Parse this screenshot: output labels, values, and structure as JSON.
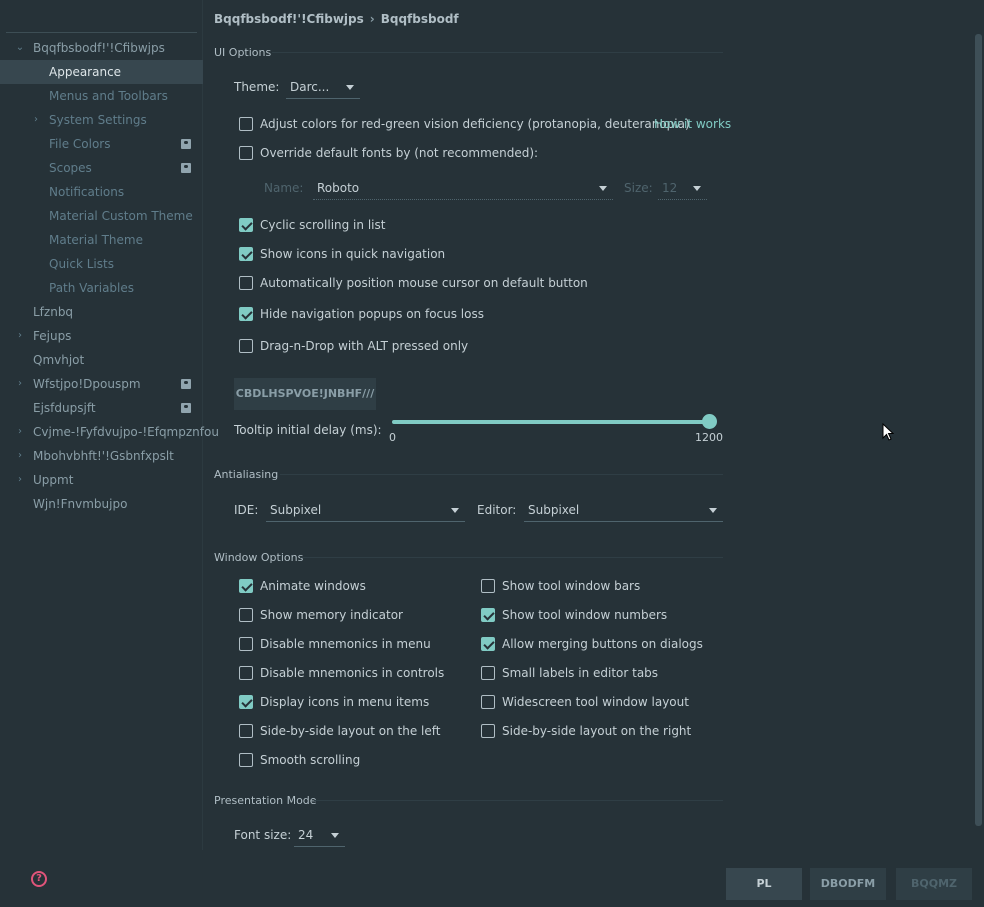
{
  "breadcrumb": {
    "parent": "Bqqfbsbodf!'!Cfibwjps",
    "current": "Bqqfbsbodf",
    "separator": "›"
  },
  "sidebar": {
    "items": [
      {
        "label": "Bqqfbsbodf!'!Cfibwjps",
        "arrow": "⌄",
        "level": 0
      },
      {
        "label": "Appearance",
        "level": 1
      },
      {
        "label": "Menus and Toolbars",
        "level": 1
      },
      {
        "label": "System Settings",
        "arrow": "›",
        "level": 1
      },
      {
        "label": "File Colors",
        "level": 1,
        "badge": true
      },
      {
        "label": "Scopes",
        "level": 1,
        "badge": true
      },
      {
        "label": "Notifications",
        "level": 1
      },
      {
        "label": "Material Custom Theme",
        "level": 1
      },
      {
        "label": "Material Theme",
        "level": 1
      },
      {
        "label": "Quick Lists",
        "level": 1
      },
      {
        "label": "Path Variables",
        "level": 1
      },
      {
        "label": "Lfznbq",
        "level": 0
      },
      {
        "label": "Fejups",
        "arrow": "›",
        "level": 0
      },
      {
        "label": "Qmvhjot",
        "level": 0
      },
      {
        "label": "Wfstjpo!Dpouspm",
        "arrow": "›",
        "level": 0,
        "badge": true
      },
      {
        "label": "Ejsfdupsjft",
        "level": 0,
        "badge": true
      },
      {
        "label": "Cvjme-!Fyfdvujpo-!Efqmpznfou",
        "arrow": "›",
        "level": 0
      },
      {
        "label": "Mbohvbhft!'!Gsbnfxpslt",
        "arrow": "›",
        "level": 0
      },
      {
        "label": "Uppmt",
        "arrow": "›",
        "level": 0
      },
      {
        "label": "Wjn!Fnvmbujpo",
        "level": 0
      }
    ]
  },
  "ui_options": {
    "title": "UI Options",
    "theme_label": "Theme:",
    "theme_value": "Darc...",
    "adjust_colors": {
      "label": "Adjust colors for red-green vision deficiency (protanopia, deuteranopia)",
      "checked": false
    },
    "how_it_works": "How it works",
    "override_fonts": {
      "label": "Override default fonts by (not recommended):",
      "checked": false
    },
    "name_label": "Name:",
    "name_value": "Roboto",
    "size_label": "Size:",
    "size_value": "12",
    "cyclic": {
      "label": "Cyclic scrolling in list",
      "checked": true
    },
    "show_icons_nav": {
      "label": "Show icons in quick navigation",
      "checked": true
    },
    "auto_position": {
      "label": "Automatically position mouse cursor on default button",
      "checked": false
    },
    "hide_popups": {
      "label": "Hide navigation popups on focus loss",
      "checked": true
    },
    "drag_drop": {
      "label": "Drag-n-Drop with ALT pressed only",
      "checked": false
    },
    "background_image_button": "CBDLHSPVOE!JNBHF///",
    "tooltip_label": "Tooltip initial delay (ms):",
    "tooltip_min": "0",
    "tooltip_max": "1200",
    "tooltip_value_fraction": 1.0
  },
  "antialiasing": {
    "title": "Antialiasing",
    "ide_label": "IDE:",
    "ide_value": "Subpixel",
    "editor_label": "Editor:",
    "editor_value": "Subpixel"
  },
  "window_options": {
    "title": "Window Options",
    "left": [
      {
        "label": "Animate windows",
        "checked": true
      },
      {
        "label": "Show memory indicator",
        "checked": false
      },
      {
        "label": "Disable mnemonics in menu",
        "checked": false
      },
      {
        "label": "Disable mnemonics in controls",
        "checked": false
      },
      {
        "label": "Display icons in menu items",
        "checked": true
      },
      {
        "label": "Side-by-side layout on the left",
        "checked": false
      },
      {
        "label": "Smooth scrolling",
        "checked": false
      }
    ],
    "right": [
      {
        "label": "Show tool window bars",
        "checked": false
      },
      {
        "label": "Show tool window numbers",
        "checked": true
      },
      {
        "label": "Allow merging buttons on dialogs",
        "checked": true
      },
      {
        "label": "Small labels in editor tabs",
        "checked": false
      },
      {
        "label": "Widescreen tool window layout",
        "checked": false
      },
      {
        "label": "Side-by-side layout on the right",
        "checked": false
      }
    ]
  },
  "presentation": {
    "title": "Presentation Mode",
    "font_size_label": "Font size:",
    "font_size_value": "24"
  },
  "buttons": {
    "ok": "PL",
    "cancel": "DBODFM",
    "apply": "BQQMZ"
  },
  "colors": {
    "accent": "#80CBC4",
    "background": "#263238",
    "selected": "#37474F",
    "help": "#E0547A"
  },
  "icons": {
    "help": "help-icon",
    "user_badge": "person-badge-icon"
  }
}
